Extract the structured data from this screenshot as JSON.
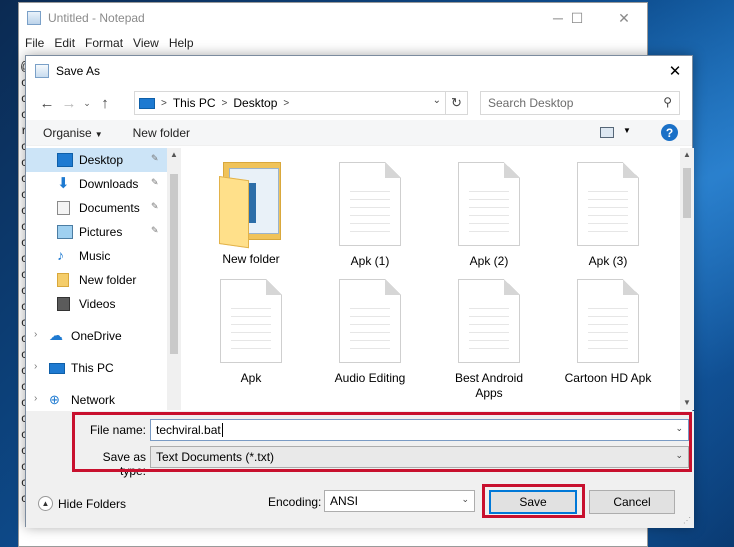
{
  "notepad": {
    "title": "Untitled - Notepad",
    "menu": [
      "File",
      "Edit",
      "Format",
      "View",
      "Help"
    ],
    "minimize_icon": "minimize-icon",
    "maximize_icon": "maximize-icon",
    "close_icon": "close-icon",
    "text_lines": [
      "@",
      "c",
      "c",
      "c",
      "r",
      "c",
      "c",
      "c",
      "c",
      "c",
      "c",
      "c",
      "c",
      "c",
      "c",
      "c",
      "c",
      "c",
      "c",
      "c",
      "c",
      "c",
      "c",
      "c",
      "c",
      "c",
      "c",
      "c"
    ]
  },
  "dialog": {
    "title": "Save As",
    "close_glyph": "✕",
    "address": {
      "crumbs": [
        "This PC",
        "Desktop"
      ],
      "separator": ">",
      "dropdown_glyph": "⌄",
      "refresh_glyph": "↻"
    },
    "search": {
      "placeholder": "Search Desktop",
      "icon": "search-icon"
    },
    "toolbar": {
      "organise": "Organise",
      "new_folder": "New folder",
      "help_glyph": "?"
    },
    "nav_pane": [
      {
        "label": "Desktop",
        "icon": "desktop-icon",
        "pinned": true,
        "selected": true
      },
      {
        "label": "Downloads",
        "icon": "downloads-icon",
        "pinned": true
      },
      {
        "label": "Documents",
        "icon": "documents-icon",
        "pinned": true
      },
      {
        "label": "Pictures",
        "icon": "pictures-icon",
        "pinned": true
      },
      {
        "label": "Music",
        "icon": "music-icon",
        "pinned": false
      },
      {
        "label": "New folder",
        "icon": "folder-icon",
        "pinned": false
      },
      {
        "label": "Videos",
        "icon": "videos-icon",
        "pinned": false
      },
      {
        "label": "OneDrive",
        "icon": "onedrive-icon",
        "pinned": false
      },
      {
        "label": "This PC",
        "icon": "this-pc-icon",
        "pinned": false
      },
      {
        "label": "Network",
        "icon": "network-icon",
        "pinned": false
      }
    ],
    "files": [
      {
        "name": "New folder",
        "type": "folder"
      },
      {
        "name": "Apk (1)",
        "type": "document"
      },
      {
        "name": "Apk (2)",
        "type": "document"
      },
      {
        "name": "Apk (3)",
        "type": "document"
      },
      {
        "name": "Apk",
        "type": "document"
      },
      {
        "name": "Audio Editing",
        "type": "document"
      },
      {
        "name": "Best Android Apps",
        "type": "document"
      },
      {
        "name": "Cartoon HD Apk",
        "type": "document"
      }
    ],
    "file_name": {
      "label": "File name:",
      "value": "techviral.bat"
    },
    "save_as_type": {
      "label": "Save as type:",
      "value": "Text Documents (*.txt)"
    },
    "hide_folders": "Hide Folders",
    "encoding": {
      "label": "Encoding:",
      "value": "ANSI"
    },
    "save_button": "Save",
    "cancel_button": "Cancel"
  },
  "colors": {
    "highlight_frame": "#c8102e",
    "selection": "#cce4f7",
    "accent": "#0078d7"
  }
}
